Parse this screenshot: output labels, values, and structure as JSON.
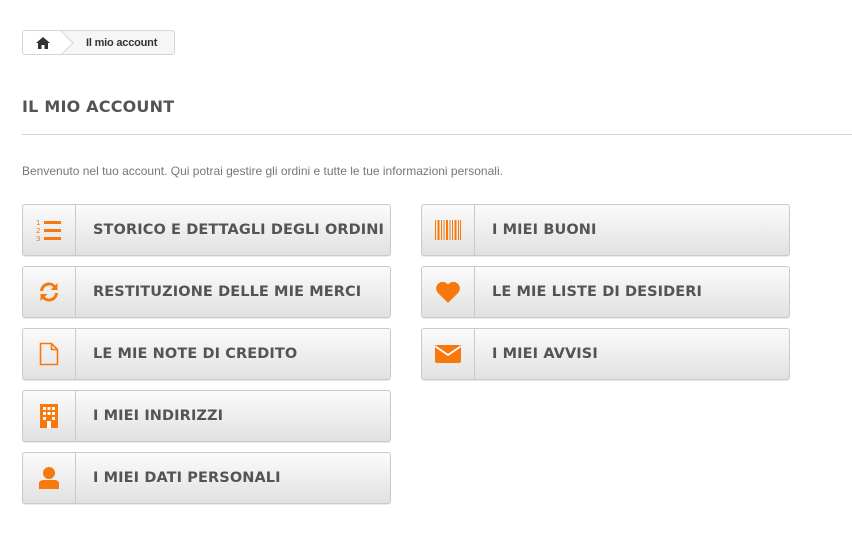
{
  "breadcrumb": {
    "home_icon": "home-icon",
    "current": "Il mio account"
  },
  "page": {
    "title": "IL MIO ACCOUNT",
    "intro": "Benvenuto nel tuo account. Qui potrai gestire gli ordini e tutte le tue informazioni personali."
  },
  "accent_color": "#f7780d",
  "buttons": [
    {
      "label": "STORICO E DETTAGLI DEGLI ORDINI",
      "icon": "ordered-list-icon"
    },
    {
      "label": "RESTITUZIONE DELLE MIE MERCI",
      "icon": "refresh-icon"
    },
    {
      "label": "LE MIE NOTE DI CREDITO",
      "icon": "file-icon"
    },
    {
      "label": "I MIEI INDIRIZZI",
      "icon": "building-icon"
    },
    {
      "label": "I MIEI DATI PERSONALI",
      "icon": "user-icon"
    },
    {
      "label": "I MIEI BUONI",
      "icon": "barcode-icon"
    },
    {
      "label": "LE MIE LISTE DI DESIDERI",
      "icon": "heart-icon"
    },
    {
      "label": "I MIEI AVVISI",
      "icon": "envelope-icon"
    }
  ]
}
